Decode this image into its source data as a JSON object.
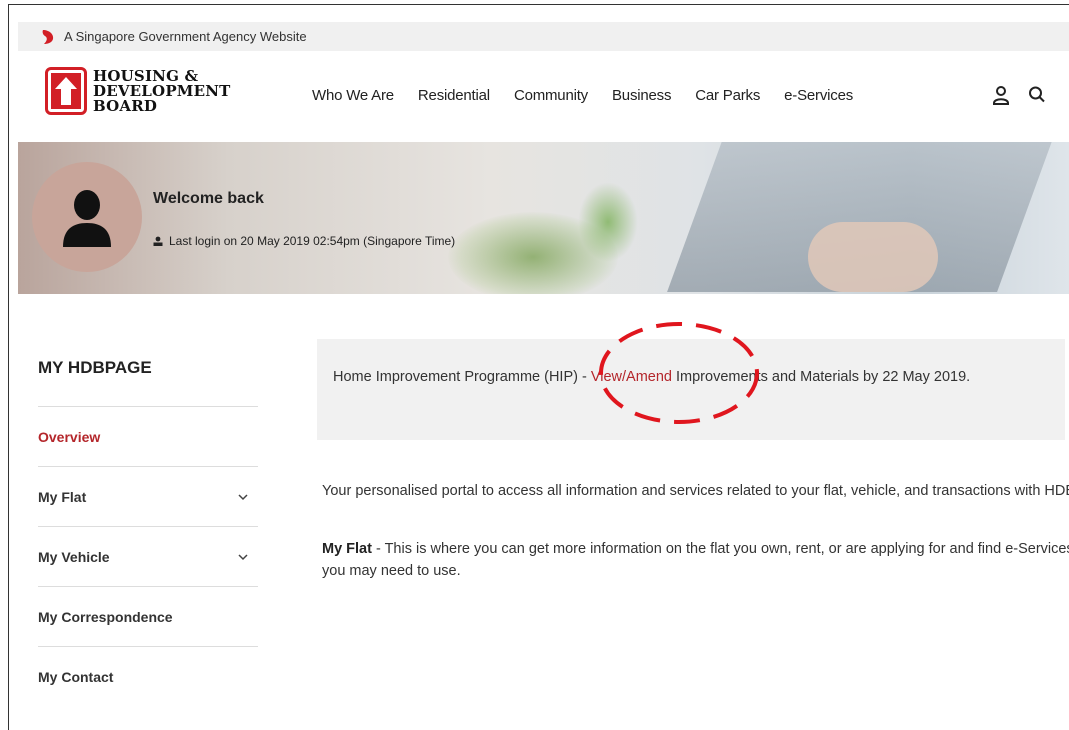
{
  "gov_strip": {
    "text": "A Singapore Government Agency Website"
  },
  "logo": {
    "lines": [
      "HOUSING &",
      "DEVELOPMENT",
      "BOARD"
    ]
  },
  "nav": [
    "Who We Are",
    "Residential",
    "Community",
    "Business",
    "Car Parks",
    "e-Services"
  ],
  "header_icons": [
    "user-icon",
    "search-icon"
  ],
  "banner": {
    "welcome": "Welcome back",
    "last_login": "Last login on 20 May 2019 02:54pm (Singapore Time)"
  },
  "sidebar": {
    "title": "MY HDBPAGE",
    "items": [
      {
        "label": "Overview",
        "active": true,
        "expandable": false
      },
      {
        "label": "My Flat",
        "active": false,
        "expandable": true
      },
      {
        "label": "My Vehicle",
        "active": false,
        "expandable": true
      },
      {
        "label": "My Correspondence",
        "active": false,
        "expandable": false
      },
      {
        "label": "My Contact",
        "active": false,
        "expandable": false
      }
    ]
  },
  "notice": {
    "before": "Home Improvement Programme (HIP) - ",
    "link": "View/Amend",
    "after": " Improvements and Materials by 22 May 2019."
  },
  "content": {
    "intro": "Your personalised portal to access all information and services related to your flat, vehicle, and transactions with HDB.",
    "my_flat_label": "My Flat",
    "my_flat_text": " - This is where you can get more information on the flat you own, rent, or are applying for and find e-Services you may need to use."
  },
  "colors": {
    "brand_red": "#d21f26",
    "link_red": "#b4262b",
    "annotation_red": "#e0161e"
  }
}
